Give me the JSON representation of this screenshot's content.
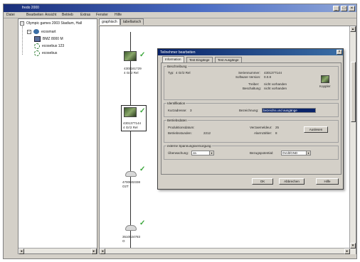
{
  "window": {
    "title": "fredo 2000"
  },
  "menu": {
    "items": [
      "Datei",
      "Bearbeiten",
      "Ansicht",
      "Betrieb",
      "Extras",
      "Fenster",
      "Hilfe"
    ]
  },
  "tree": {
    "root": "Olympic games 2003 Stadium, Hall",
    "items": [
      "ecosmart",
      "BMZ 8000 M",
      "ecosebus 123",
      "ecosebus"
    ]
  },
  "main_tabs": [
    "graphisch",
    "tabellarisch"
  ],
  "devices": [
    {
      "label": "4301161729\n4 Gr/2 Rel"
    },
    {
      "label": "4301377144\n4 Gr/2 Rel"
    },
    {
      "label": "4700602338\nO2T"
    },
    {
      "label": "3510524783\nO"
    }
  ],
  "dialog": {
    "title": "Teilnehmer bearbeiten",
    "close": "×",
    "tabs": [
      "Information",
      "Test Eingänge",
      "Test Ausgänge"
    ],
    "beschreibung": {
      "title": "Beschreibung",
      "typ_label": "Typ:",
      "typ_value": "4 Gr/2 Rel",
      "seriennummer_label": "Seriennummer:",
      "seriennummer_value": "4301377144",
      "software_label": "Software Version:",
      "software_value": "0.0.8",
      "treiber_label": "Treiber:",
      "treiber_value": "nicht vorhanden",
      "beschaltung_label": "Beschaltung:",
      "beschaltung_value": "nicht vorhanden",
      "koppler_label": "Koppler"
    },
    "identifikation": {
      "title": "Identifikation",
      "kurzadresse_label": "Kurzadresse:",
      "kurzadresse_value": "3",
      "bezeichnung_label": "Bezeichnung:",
      "bezeichnung_value": "bezeichn.und ausgänge"
    },
    "betriebsdaten": {
      "title": "Betriebsdaten",
      "produktionsdatum_label": "Produktionsdatum:",
      "produktionsdatum_value": "",
      "betriebsstunden_label": "Betriebsstunden:",
      "betriebsstunden_value": "2212",
      "verzoegerung_label": "Verzaemeldeur:",
      "verzoegerung_value": "25",
      "alarmzaehler_label": "Alarmzähler:",
      "alarmzaehler_value": "8",
      "auslesen_button": "Auslesen"
    },
    "spannung": {
      "title": "externe Spannungsversorgung",
      "ueberwachung_label": "Überwachung:",
      "ueberwachung_value": "Ja",
      "bezugspotential_label": "Bezugspotential:",
      "bezugspotential_value": "0Volt/GND"
    },
    "buttons": {
      "ok": "OK",
      "abbrechen": "Abbrechen",
      "hilfe": "Hilfe"
    }
  },
  "icons": {
    "minimize": "minimize-icon",
    "maximize": "maximize-icon",
    "close": "close-icon",
    "check": "checkmark-icon"
  },
  "colors": {
    "titlebar": "#1a2f7a",
    "dialog_titlebar": "#0a246a",
    "check": "#3aa63a",
    "selection": "#0a246a"
  }
}
